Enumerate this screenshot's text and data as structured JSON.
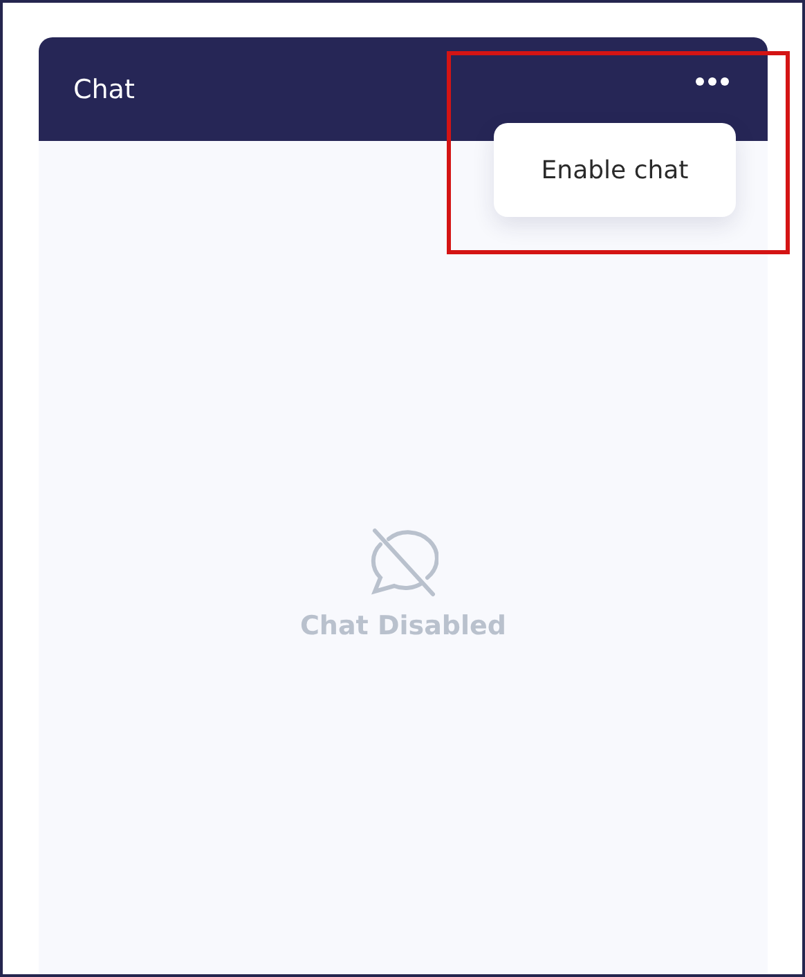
{
  "panel": {
    "title": "Chat",
    "menu": {
      "items": [
        {
          "label": "Enable chat"
        }
      ]
    },
    "empty_state": {
      "label": "Chat Disabled"
    }
  }
}
